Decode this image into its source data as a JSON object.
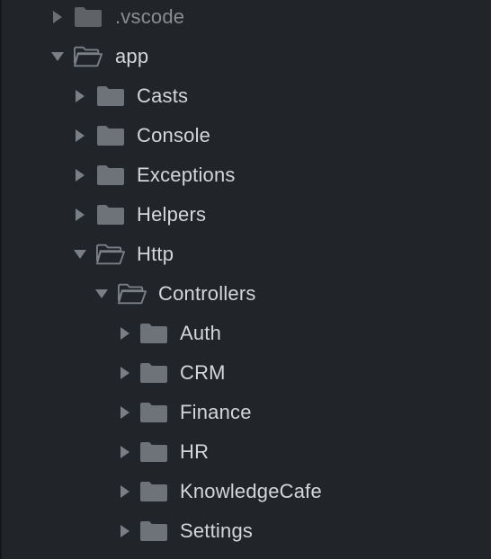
{
  "explorer": {
    "items": [
      {
        "label": ".vscode",
        "expanded": false,
        "depth": 0,
        "dim": true
      },
      {
        "label": "app",
        "expanded": true,
        "depth": 0
      },
      {
        "label": "Casts",
        "expanded": false,
        "depth": 1
      },
      {
        "label": "Console",
        "expanded": false,
        "depth": 1
      },
      {
        "label": "Exceptions",
        "expanded": false,
        "depth": 1
      },
      {
        "label": "Helpers",
        "expanded": false,
        "depth": 1
      },
      {
        "label": "Http",
        "expanded": true,
        "depth": 1
      },
      {
        "label": "Controllers",
        "expanded": true,
        "depth": 2
      },
      {
        "label": "Auth",
        "expanded": false,
        "depth": 3
      },
      {
        "label": "CRM",
        "expanded": false,
        "depth": 3
      },
      {
        "label": "Finance",
        "expanded": false,
        "depth": 3
      },
      {
        "label": "HR",
        "expanded": false,
        "depth": 3
      },
      {
        "label": "KnowledgeCafe",
        "expanded": false,
        "depth": 3
      },
      {
        "label": "Settings",
        "expanded": false,
        "depth": 3
      }
    ]
  },
  "icons": {
    "collapsed_chevron": "chevron-right-icon",
    "expanded_chevron": "chevron-down-icon",
    "closed_folder": "folder-icon",
    "open_folder": "folder-open-icon"
  },
  "colors": {
    "background": "#212428",
    "text": "#d3d6da",
    "icon": "#6e7379"
  }
}
